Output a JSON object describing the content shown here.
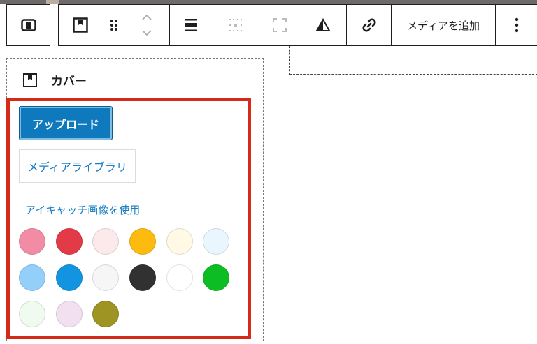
{
  "toolbar": {
    "add_media_label": "メディアを追加",
    "icons": [
      "align-block-icon",
      "cover-icon",
      "drag-handle-icon",
      "move-up-down-icon",
      "wide-align-icon",
      "content-position-icon",
      "full-height-icon",
      "contrast-icon",
      "link-icon",
      "more-options-icon"
    ]
  },
  "panel": {
    "title": "カバー",
    "upload_label": "アップロード",
    "media_library_label": "メディアライブラリ",
    "featured_image_label": "アイキャッチ画像を使用"
  },
  "swatches": [
    {
      "name": "pink",
      "color": "#f28ca5"
    },
    {
      "name": "red",
      "color": "#e33a48"
    },
    {
      "name": "light-pink",
      "color": "#fbe9ec"
    },
    {
      "name": "amber",
      "color": "#fdbb0f"
    },
    {
      "name": "light-yellow",
      "color": "#fff9e6"
    },
    {
      "name": "light-blue",
      "color": "#eaf6fd"
    },
    {
      "name": "sky-blue",
      "color": "#94cff9"
    },
    {
      "name": "blue",
      "color": "#1394e0"
    },
    {
      "name": "very-light-gray",
      "color": "#f6f6f6"
    },
    {
      "name": "dark-gray",
      "color": "#313131"
    },
    {
      "name": "white",
      "color": "#ffffff"
    },
    {
      "name": "green",
      "color": "#0cbd23"
    },
    {
      "name": "light-green",
      "color": "#f0fbf0"
    },
    {
      "name": "light-purple",
      "color": "#f2e0f0"
    },
    {
      "name": "olive",
      "color": "#9d9423"
    }
  ],
  "colors": {
    "accent": "#0f79bd",
    "link": "#1a7ec4",
    "highlight_border": "#d42a17"
  }
}
